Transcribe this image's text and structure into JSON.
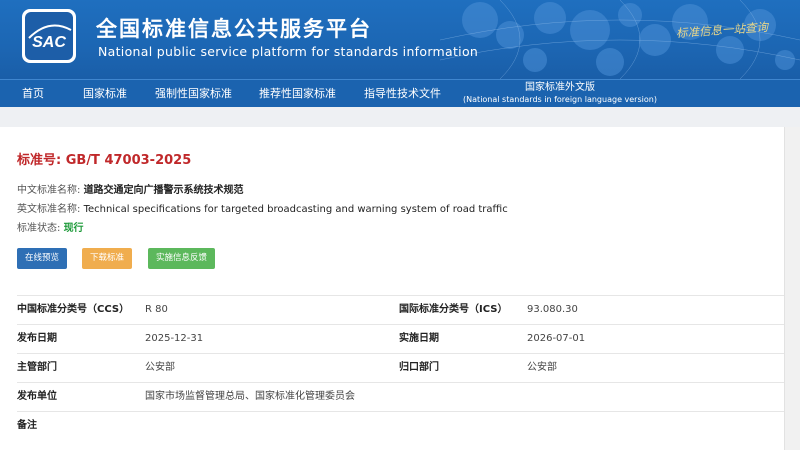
{
  "header": {
    "logo_text": "SAC",
    "title": "全国标准信息公共服务平台",
    "subtitle": "National public service platform  for standards information",
    "slogan": "标准信息一站查询"
  },
  "nav": {
    "items": [
      "首页",
      "国家标准",
      "强制性国家标准",
      "推荐性国家标准",
      "指导性技术文件"
    ],
    "foreign_line1": "国家标准外文版",
    "foreign_line2": "(National standards in foreign language version)"
  },
  "standard": {
    "number_label": "标准号:",
    "number": "GB/T 47003-2025",
    "cn_name_label": "中文标准名称:",
    "cn_name": "道路交通定向广播警示系统技术规范",
    "en_name_label": "英文标准名称:",
    "en_name": "Technical specifications for targeted broadcasting and warning system of road traffic",
    "status_label": "标准状态:",
    "status": "现行"
  },
  "buttons": {
    "preview": "在线预览",
    "download": "下载标准",
    "feedback": "实施信息反馈"
  },
  "details": [
    {
      "l1": "中国标准分类号（CCS）",
      "v1": "R 80",
      "l2": "国际标准分类号（ICS）",
      "v2": "93.080.30"
    },
    {
      "l1": "发布日期",
      "v1": "2025-12-31",
      "l2": "实施日期",
      "v2": "2026-07-01"
    },
    {
      "l1": "主管部门",
      "v1": "公安部",
      "l2": "归口部门",
      "v2": "公安部"
    },
    {
      "l1": "发布单位",
      "v1": "国家市场监督管理总局、国家标准化管理委员会",
      "l2": "",
      "v2": ""
    },
    {
      "l1": "备注",
      "v1": "",
      "l2": "",
      "v2": ""
    }
  ],
  "colors": {
    "banner_blue": "#1c66b3",
    "nav_blue": "#1b63af",
    "title_red": "#c0282a",
    "status_green": "#1e9a3a",
    "btn_blue": "#2e6fb5",
    "btn_orange": "#f0ad4e",
    "btn_green": "#5cb85c"
  }
}
